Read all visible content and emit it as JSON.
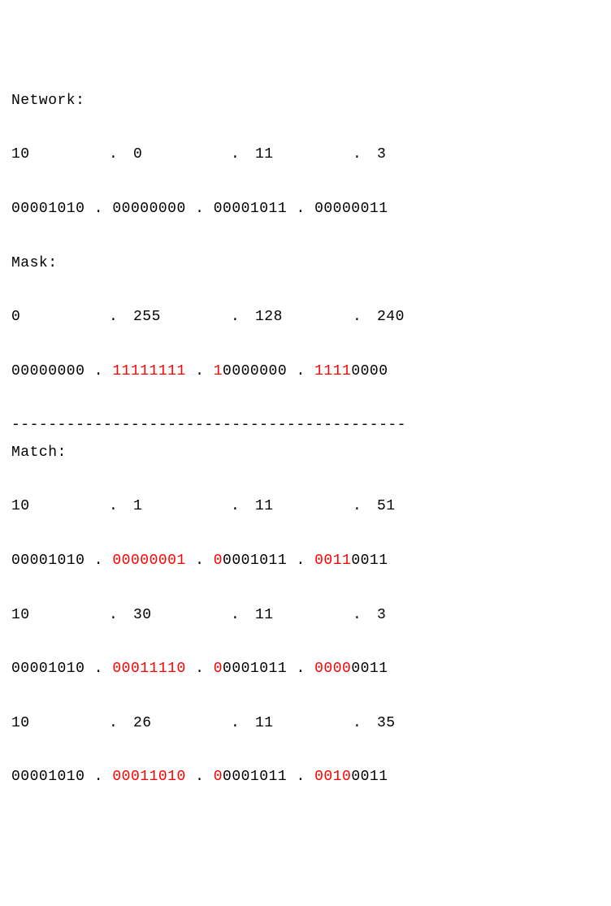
{
  "labels": {
    "network": "Network:",
    "mask": "Mask:",
    "match": "Match:"
  },
  "sep": ".",
  "hr": "-------------------------------------------",
  "network": {
    "dec": [
      "10",
      "0",
      "11",
      "3"
    ],
    "bin": {
      "o1": {
        "p": "00001010",
        "r": "",
        "s": ""
      },
      "o2": {
        "p": "00000000",
        "r": "",
        "s": ""
      },
      "o3": {
        "p": "00001011",
        "r": "",
        "s": ""
      },
      "o4": {
        "p": "00000011",
        "r": "",
        "s": ""
      }
    }
  },
  "mask": {
    "dec": [
      "0",
      "255",
      "128",
      "240"
    ],
    "bin": {
      "o1": {
        "p": "00000000",
        "r": "",
        "s": ""
      },
      "o2": {
        "p": "",
        "r": "11111111",
        "s": ""
      },
      "o3": {
        "p": "",
        "r": "1",
        "s": "0000000"
      },
      "o4": {
        "p": "",
        "r": "1111",
        "s": "0000"
      }
    }
  },
  "matches": [
    {
      "dec": [
        "10",
        "1",
        "11",
        "51"
      ],
      "bin": {
        "o1": {
          "p": "00001010",
          "r": "",
          "s": ""
        },
        "o2": {
          "p": "",
          "r": "00000001",
          "s": ""
        },
        "o3": {
          "p": "",
          "r": "0",
          "s": "0001011"
        },
        "o4": {
          "p": "",
          "r": "0011",
          "s": "0011"
        }
      }
    },
    {
      "dec": [
        "10",
        "30",
        "11",
        "3"
      ],
      "bin": {
        "o1": {
          "p": "00001010",
          "r": "",
          "s": ""
        },
        "o2": {
          "p": "",
          "r": "00011110",
          "s": ""
        },
        "o3": {
          "p": "",
          "r": "0",
          "s": "0001011"
        },
        "o4": {
          "p": "",
          "r": "0000",
          "s": "0011"
        }
      }
    },
    {
      "dec": [
        "10",
        "26",
        "11",
        "35"
      ],
      "bin": {
        "o1": {
          "p": "00001010",
          "r": "",
          "s": ""
        },
        "o2": {
          "p": "",
          "r": "00011010",
          "s": ""
        },
        "o3": {
          "p": "",
          "r": "0",
          "s": "0001011"
        },
        "o4": {
          "p": "",
          "r": "0010",
          "s": "0011"
        }
      }
    }
  ]
}
